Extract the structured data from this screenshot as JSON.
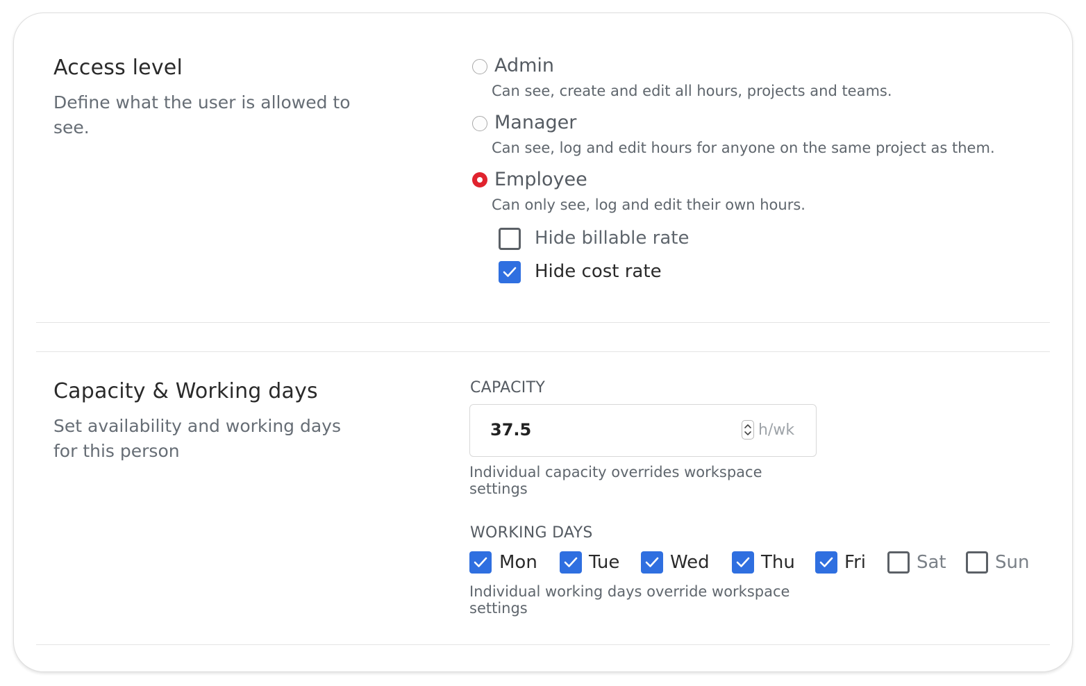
{
  "access": {
    "title": "Access level",
    "description": "Define what the user is allowed to see.",
    "options": [
      {
        "label": "Admin",
        "description": "Can see, create and edit all hours, projects and teams.",
        "selected": false
      },
      {
        "label": "Manager",
        "description": "Can see, log and edit hours for anyone on the same project as them.",
        "selected": false
      },
      {
        "label": "Employee",
        "description": "Can only see, log and edit their own hours.",
        "selected": true
      }
    ],
    "suboptions": [
      {
        "label": "Hide billable rate",
        "checked": false
      },
      {
        "label": "Hide cost rate",
        "checked": true
      }
    ]
  },
  "capacity": {
    "title": "Capacity & Working days",
    "description": "Set availability and working days for this person",
    "capacity_label": "CAPACITY",
    "capacity_value": "37.5",
    "capacity_unit": "h/wk",
    "capacity_help": "Individual capacity overrides workspace settings",
    "working_days_label": "WORKING DAYS",
    "days": [
      {
        "label": "Mon",
        "checked": true
      },
      {
        "label": "Tue",
        "checked": true
      },
      {
        "label": "Wed",
        "checked": true
      },
      {
        "label": "Thu",
        "checked": true
      },
      {
        "label": "Fri",
        "checked": true
      },
      {
        "label": "Sat",
        "checked": false
      },
      {
        "label": "Sun",
        "checked": false
      }
    ],
    "working_days_help": "Individual working days override workspace settings"
  },
  "colors": {
    "accent_blue": "#2f6fe0",
    "radio_selected": "#e0232e",
    "text_dark": "#2a2a2a",
    "text_muted": "#5f666d"
  },
  "icons": {
    "checkmark": "check-icon",
    "spinner": "number-stepper-icon"
  }
}
